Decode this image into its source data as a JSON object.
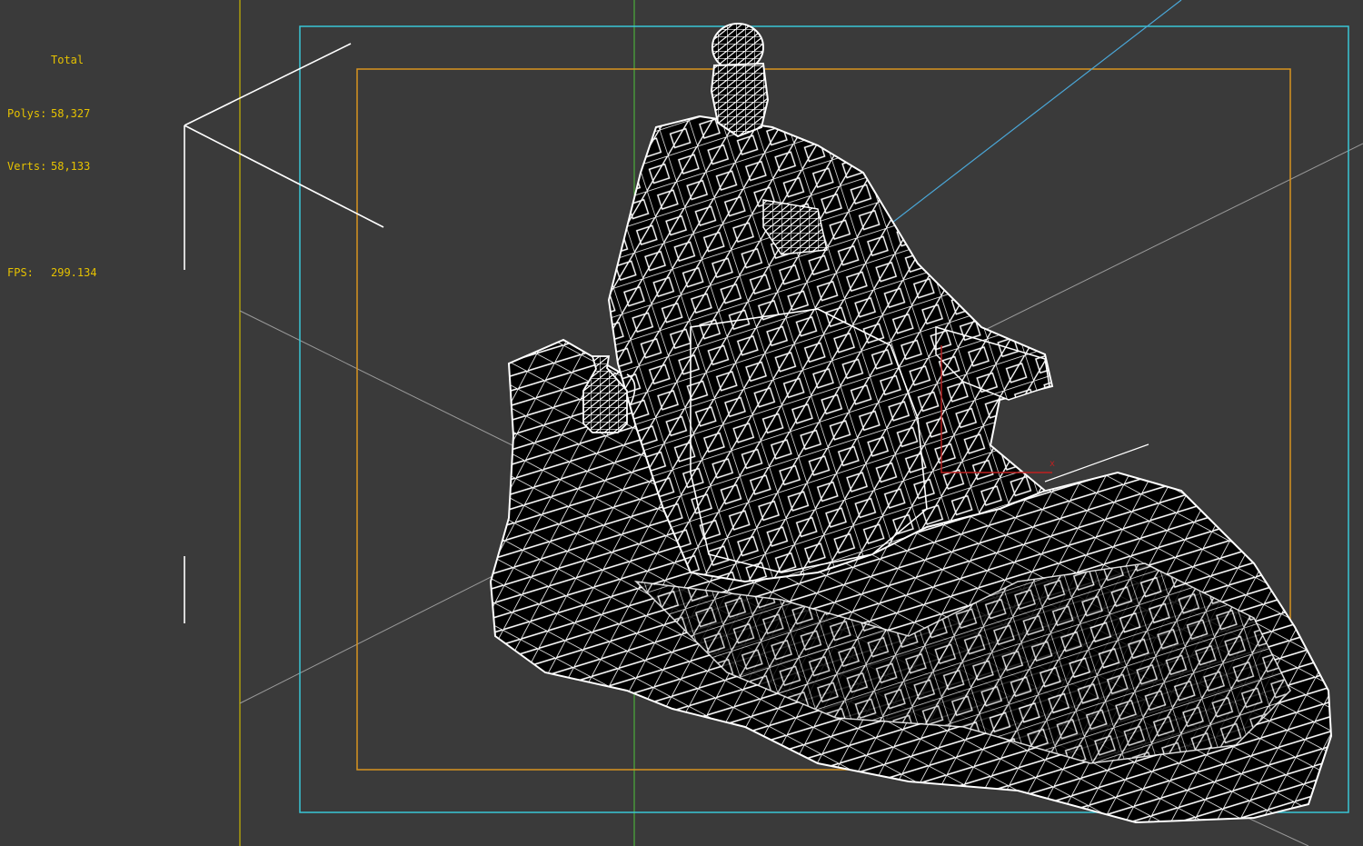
{
  "stats": {
    "header": "Total",
    "polys_label": "Polys:",
    "polys_value": "58,327",
    "verts_label": "Verts:",
    "verts_value": "58,133",
    "fps_label": "FPS:",
    "fps_value": "299.134"
  },
  "colors": {
    "background": "#3a3a3a",
    "stats_text": "#e6c200",
    "safe_frame_outer": "#39c6d6",
    "safe_frame_inner": "#d7931f",
    "viewport_guide": "#c8b400",
    "green_guide": "#4fc23a",
    "light_line": "#4aa7d8",
    "wireframe": "#ffffff",
    "mesh_fill": "#000000",
    "gizmo_axis": "#c02020"
  },
  "icons": {
    "camera": "camera-icon",
    "light": "light-icon",
    "gizmo": "transform-gizmo-icon"
  }
}
